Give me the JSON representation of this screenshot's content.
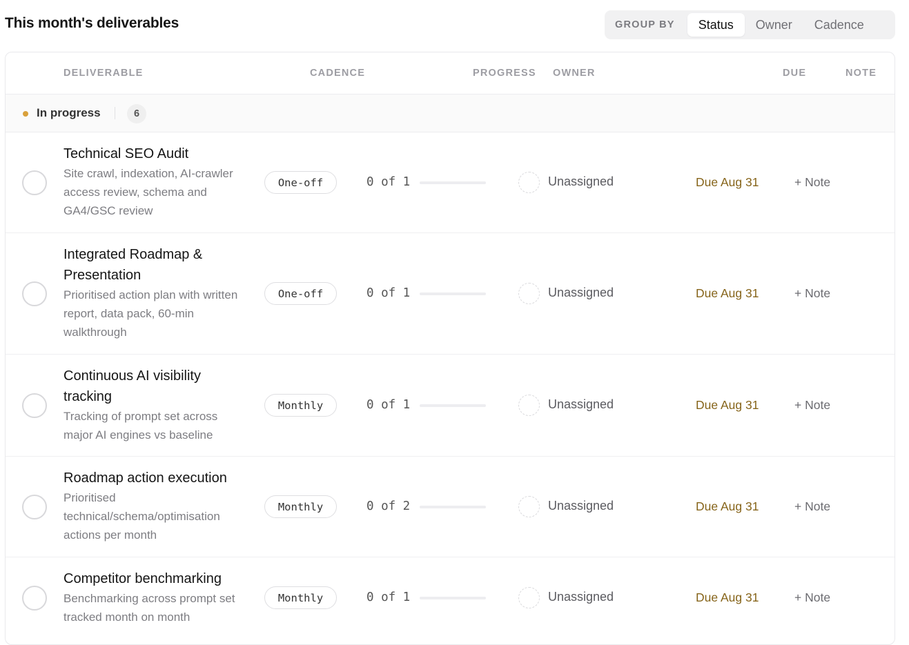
{
  "header": {
    "title": "This month's deliverables",
    "group_by_label": "GROUP BY",
    "group_by_options": [
      "Status",
      "Owner",
      "Cadence"
    ],
    "group_by_selected": "Status"
  },
  "columns": {
    "deliverable": "DELIVERABLE",
    "cadence": "CADENCE",
    "progress": "PROGRESS",
    "owner": "OWNER",
    "due": "DUE",
    "note": "NOTE"
  },
  "group": {
    "label": "In progress",
    "count": "6",
    "color": "#d9a13c"
  },
  "rows": [
    {
      "title": "Technical SEO Audit",
      "description": "Site crawl, indexation, AI-crawler access review, schema and GA4/GSC review",
      "cadence": "One-off",
      "progress_text": "0 of 1",
      "progress_fraction": 0,
      "owner": "Unassigned",
      "due": "Due Aug 31",
      "note": "+ Note"
    },
    {
      "title": "Integrated Roadmap & Presentation",
      "description": "Prioritised action plan with written report, data pack, 60-min walkthrough",
      "cadence": "One-off",
      "progress_text": "0 of 1",
      "progress_fraction": 0,
      "owner": "Unassigned",
      "due": "Due Aug 31",
      "note": "+ Note"
    },
    {
      "title": "Continuous AI visibility tracking",
      "description": "Tracking of prompt set across major AI engines vs baseline",
      "cadence": "Monthly",
      "progress_text": "0 of 1",
      "progress_fraction": 0,
      "owner": "Unassigned",
      "due": "Due Aug 31",
      "note": "+ Note"
    },
    {
      "title": "Roadmap action execution",
      "description": "Prioritised technical/schema/optimisation actions per month",
      "cadence": "Monthly",
      "progress_text": "0 of 2",
      "progress_fraction": 0,
      "owner": "Unassigned",
      "due": "Due Aug 31",
      "note": "+ Note"
    },
    {
      "title": "Competitor benchmarking",
      "description": "Benchmarking across prompt set tracked month on month",
      "cadence": "Monthly",
      "progress_text": "0 of 1",
      "progress_fraction": 0,
      "owner": "Unassigned",
      "due": "Due Aug 31",
      "note": "+ Note"
    }
  ]
}
